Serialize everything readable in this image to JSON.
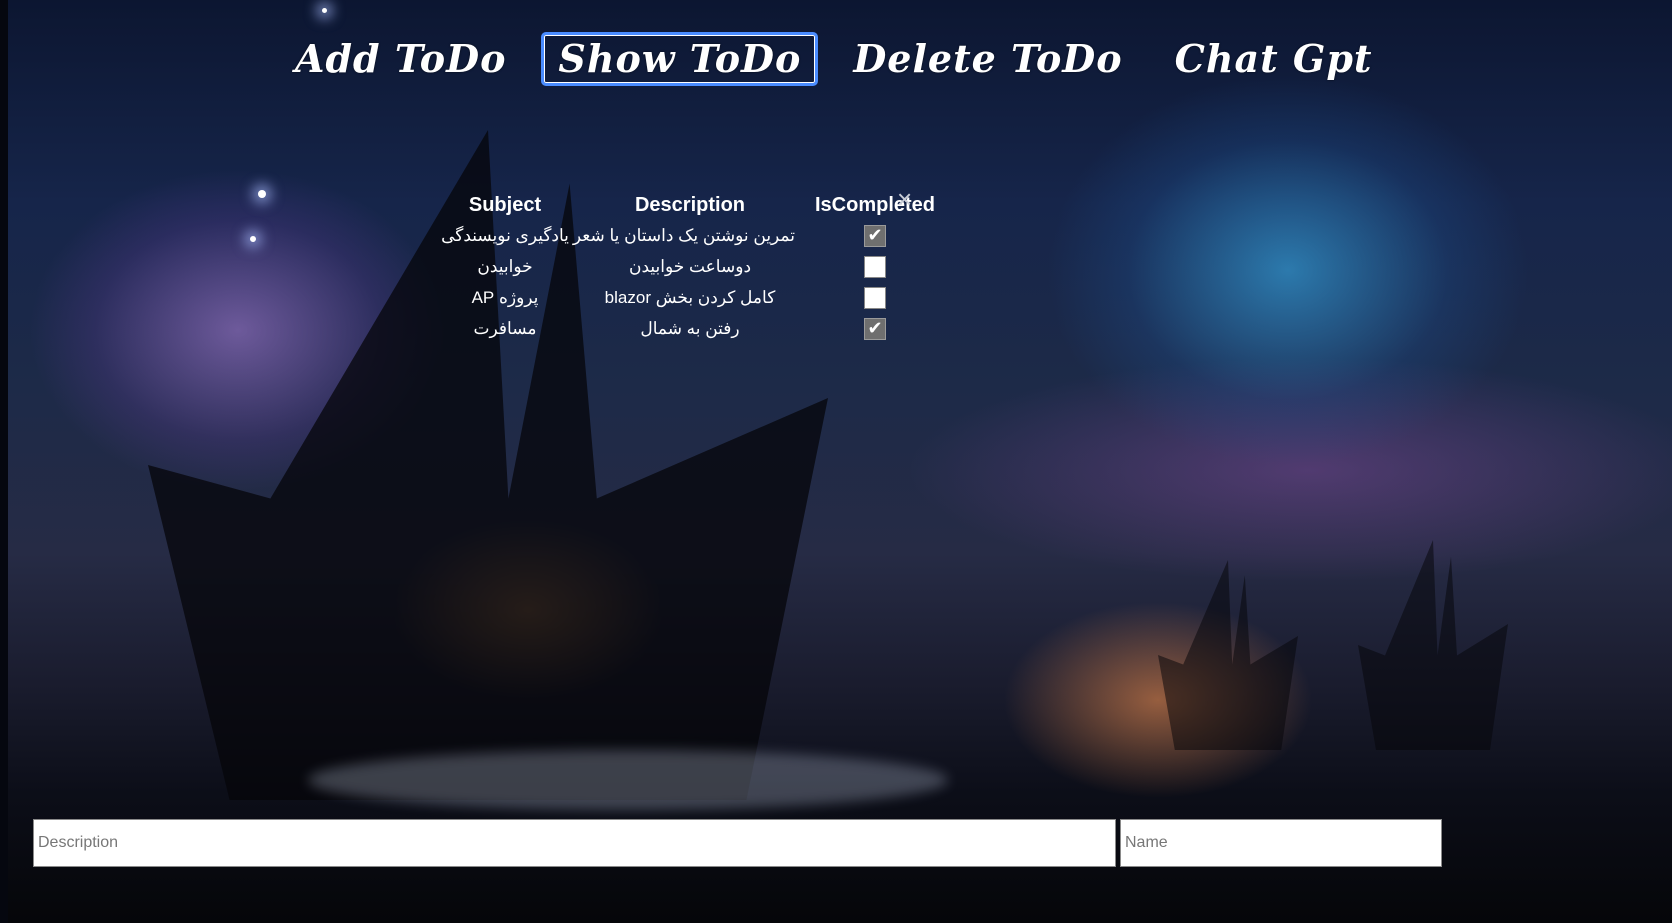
{
  "nav": {
    "items": [
      {
        "label": "Add ToDo",
        "active": false
      },
      {
        "label": "Show ToDo",
        "active": true
      },
      {
        "label": "Delete ToDo",
        "active": false
      },
      {
        "label": "Chat Gpt",
        "active": false
      }
    ]
  },
  "table": {
    "headers": {
      "subject": "Subject",
      "description": "Description",
      "completed": "IsCompleted"
    },
    "close_icon": "×",
    "rows": [
      {
        "subject": "یادگیری نویسندگی",
        "description": "تمرین نوشتن یک داستان یا شعر",
        "completed": true
      },
      {
        "subject": "خوابیدن",
        "description": "دوساعت خوابیدن",
        "completed": false
      },
      {
        "subject": "پروژه AP",
        "description": "کامل کردن بخش blazor",
        "completed": false
      },
      {
        "subject": "مسافرت",
        "description": "رفتن به شمال",
        "completed": true
      }
    ]
  },
  "form": {
    "description_placeholder": "Description",
    "name_placeholder": "Name"
  },
  "icons": {
    "check": "check-icon",
    "close": "close-icon"
  },
  "colors": {
    "active_border": "#4a8cff",
    "checked_bg": "#6f6f6f"
  }
}
